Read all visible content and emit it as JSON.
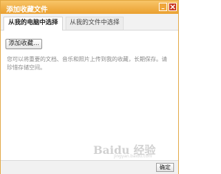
{
  "window": {
    "title": "添加收藏文件"
  },
  "tabs": [
    {
      "label": "从我的电脑中选择",
      "active": true
    },
    {
      "label": "从我的文件中选择",
      "active": false
    }
  ],
  "main": {
    "add_button_label": "添加收藏...",
    "hint_text": "您可以将重要的文档、音乐和照片上传到我的收藏，长期保存。请珍惜存储空间。"
  },
  "watermark": {
    "brand": "Baidu 经验",
    "url": "jingyan.baidu.com"
  },
  "footer": {
    "ok_label": "确定"
  },
  "colors": {
    "titlebar": "#efa63c",
    "close_button": "#c9371f",
    "border": "#e2a640"
  }
}
